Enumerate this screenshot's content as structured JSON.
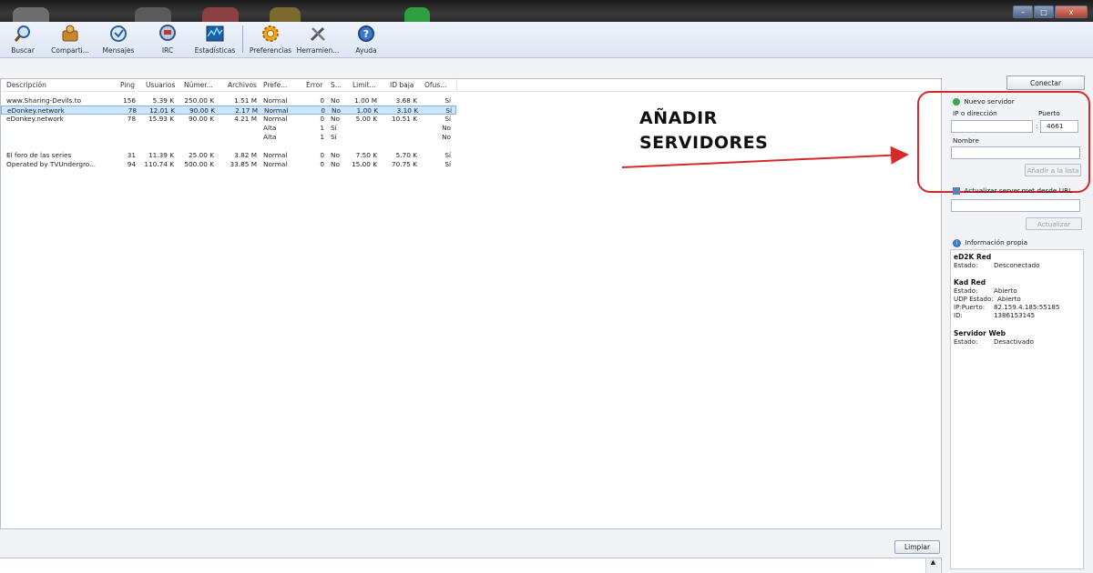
{
  "window": {
    "controls": {
      "minimize": "–",
      "maximize": "□",
      "close": "x"
    }
  },
  "toolbar": {
    "items": [
      {
        "label": "Buscar",
        "icon": "search-magnifier-icon"
      },
      {
        "label": "Comparti...",
        "icon": "shared-files-icon"
      },
      {
        "label": "Mensajes",
        "icon": "messages-icon"
      },
      {
        "label": "IRC",
        "icon": "irc-chat-icon"
      },
      {
        "label": "Estadísticas",
        "icon": "statistics-icon"
      },
      {
        "label": "Preferencias",
        "icon": "preferences-gear-icon"
      },
      {
        "label": "Herramien...",
        "icon": "tools-icon"
      },
      {
        "label": "Ayuda",
        "icon": "help-icon"
      }
    ]
  },
  "server_list": {
    "columns": [
      "Descripción",
      "Ping",
      "Usuarios",
      "Númer...",
      "Archivos",
      "Prefe...",
      "Error",
      "S...",
      "Limit...",
      "ID baja",
      "Ofus..."
    ],
    "rows": [
      {
        "desc": "www.Sharing-Devils.to",
        "ping": "156",
        "users": "5.39 K",
        "num": "250.00 K",
        "files": "1.51 M",
        "pref": "Normal",
        "error": "0",
        "s": "No",
        "limit": "1.00 M",
        "lowid": "3.68 K",
        "obf": "Sí",
        "selected": false
      },
      {
        "desc": "eDonkey.network",
        "ping": "78",
        "users": "12.01 K",
        "num": "90.00 K",
        "files": "2.17 M",
        "pref": "Normal",
        "error": "0",
        "s": "No",
        "limit": "1.00 K",
        "lowid": "3.10 K",
        "obf": "Sí",
        "selected": true
      },
      {
        "desc": "eDonkey.network",
        "ping": "78",
        "users": "15.93 K",
        "num": "90.00 K",
        "files": "4.21 M",
        "pref": "Normal",
        "error": "0",
        "s": "No",
        "limit": "5.00 K",
        "lowid": "10.51 K",
        "obf": "Sí",
        "selected": false
      },
      {
        "desc": "",
        "ping": "",
        "users": "",
        "num": "",
        "files": "",
        "pref": "Alta",
        "error": "1",
        "s": "Sí",
        "limit": "",
        "lowid": "",
        "obf": "No",
        "selected": false
      },
      {
        "desc": "",
        "ping": "",
        "users": "",
        "num": "",
        "files": "",
        "pref": "Alta",
        "error": "1",
        "s": "Sí",
        "limit": "",
        "lowid": "",
        "obf": "No",
        "selected": false
      },
      {
        "desc": "El foro de las series",
        "ping": "31",
        "users": "11.39 K",
        "num": "25.00 K",
        "files": "3.82 M",
        "pref": "Normal",
        "error": "0",
        "s": "No",
        "limit": "7.50 K",
        "lowid": "5.70 K",
        "obf": "Sí",
        "selected": false
      },
      {
        "desc": "Operated by TVUndergro...",
        "ping": "94",
        "users": "110.74 K",
        "num": "500.00 K",
        "files": "33.85 M",
        "pref": "Normal",
        "error": "0",
        "s": "No",
        "limit": "15.00 K",
        "lowid": "70.75 K",
        "obf": "Sí",
        "selected": false
      }
    ]
  },
  "bottom": {
    "clear_label": "Limpiar"
  },
  "side": {
    "connect_label": "Conectar",
    "new_server": {
      "title": "Nuevo servidor",
      "ip_label": "IP o dirección",
      "port_label": "Puerto",
      "ip_value": "",
      "port_separator": ":",
      "port_value": "4661",
      "name_label": "Nombre",
      "name_value": "",
      "add_label": "Añadir a la lista"
    },
    "update": {
      "title": "Actualizar server.met desde URL",
      "url_value": "",
      "button_label": "Actualizar"
    },
    "info": {
      "title": "Información propia",
      "ed2k_title": "eD2K Red",
      "ed2k_state_label": "Estado:",
      "ed2k_state_value": "Desconectado",
      "kad_title": "Kad Red",
      "kad_state_label": "Estado:",
      "kad_state_value": "Abierto",
      "kad_udp_label": "UDP Estado:",
      "kad_udp_value": "Abierto",
      "kad_ip_label": "IP:Puerto:",
      "kad_ip_value": "82.159.4.185:55185",
      "kad_id_label": "ID:",
      "kad_id_value": "1386153145",
      "web_title": "Servidor Web",
      "web_state_label": "Estado:",
      "web_state_value": "Desactivado"
    }
  },
  "annotation": {
    "line1": "AÑADIR",
    "line2": "SERVIDORES",
    "color": "#d42a2a"
  }
}
